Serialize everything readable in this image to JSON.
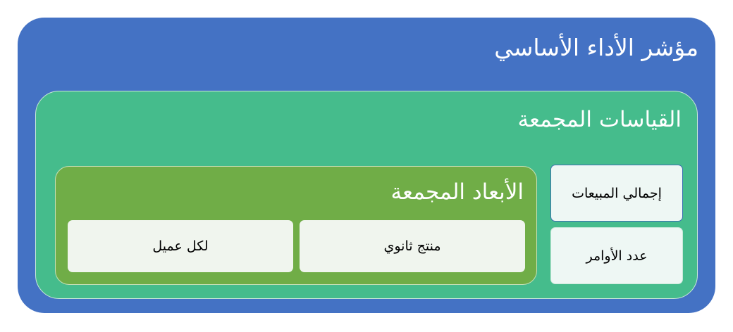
{
  "kpi": {
    "title": "مؤشر الأداء الأساسي",
    "measures": {
      "title": "القياسات المجمعة",
      "items": [
        {
          "label": "إجمالي المبيعات"
        },
        {
          "label": "عدد الأوامر"
        }
      ]
    },
    "dimensions": {
      "title": "الأبعاد المجمعة",
      "items": [
        {
          "label": "منتج ثانوي"
        },
        {
          "label": "لكل عميل"
        }
      ]
    }
  },
  "colors": {
    "outer": "#4472c4",
    "measures": "#45bc8c",
    "dimensions": "#70ad47",
    "box": "#f0f5ee"
  }
}
